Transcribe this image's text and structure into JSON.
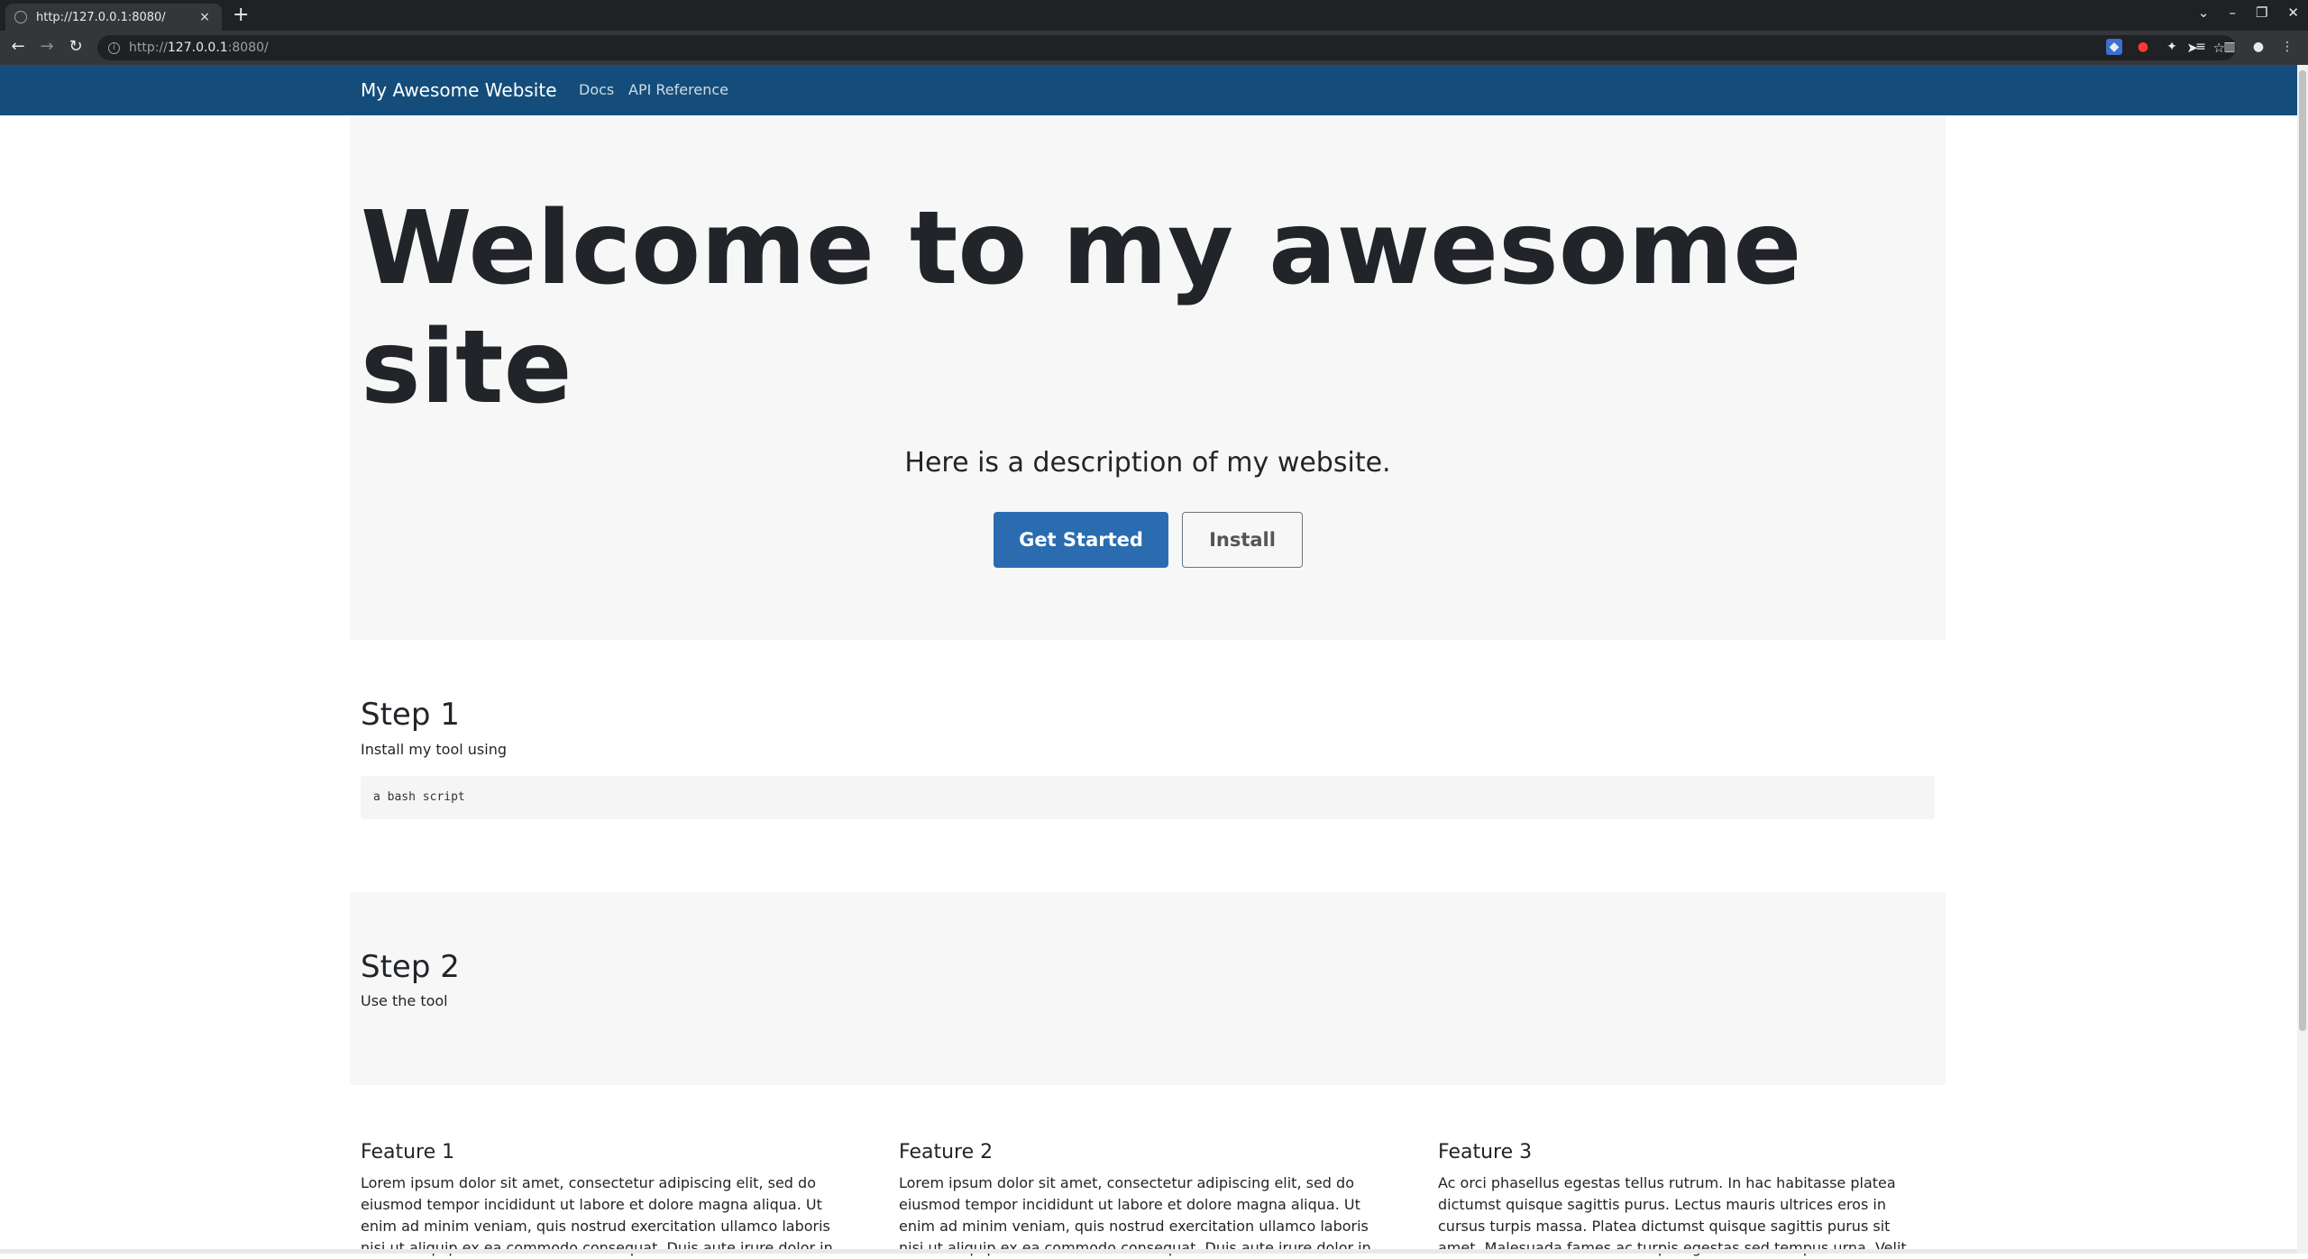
{
  "browser": {
    "tab_title": "http://127.0.0.1:8080/",
    "url_scheme": "http://",
    "url_host": "127.0.0.1",
    "url_rest": ":8080/",
    "new_tab_glyph": "+",
    "close_glyph": "×"
  },
  "site": {
    "brand": "My Awesome Website",
    "nav": [
      "Docs",
      "API Reference"
    ],
    "hero": {
      "title": "Welcome to my awesome site",
      "description": "Here is a description of my website.",
      "primary_button": "Get Started",
      "secondary_button": "Install"
    },
    "step1": {
      "title": "Step 1",
      "text": "Install my tool using",
      "code": "a bash script"
    },
    "step2": {
      "title": "Step 2",
      "text": "Use the tool"
    },
    "features": [
      {
        "title": "Feature 1",
        "text": "Lorem ipsum dolor sit amet, consectetur adipiscing elit, sed do eiusmod tempor incididunt ut labore et dolore magna aliqua. Ut enim ad minim veniam, quis nostrud exercitation ullamco laboris nisi ut aliquip ex ea commodo consequat. Duis aute irure dolor in"
      },
      {
        "title": "Feature 2",
        "text": "Lorem ipsum dolor sit amet, consectetur adipiscing elit, sed do eiusmod tempor incididunt ut labore et dolore magna aliqua. Ut enim ad minim veniam, quis nostrud exercitation ullamco laboris nisi ut aliquip ex ea commodo consequat. Duis aute irure dolor in"
      },
      {
        "title": "Feature 3",
        "text": "Ac orci phasellus egestas tellus rutrum. In hac habitasse platea dictumst quisque sagittis purus. Lectus mauris ultrices eros in cursus turpis massa. Platea dictumst quisque sagittis purus sit amet. Malesuada fames ac turpis egestas sed tempus urna. Velit"
      }
    ]
  },
  "colors": {
    "navbar": "#144d7b",
    "primary": "#2b6cb0",
    "hero_bg": "#f7f7f7"
  }
}
